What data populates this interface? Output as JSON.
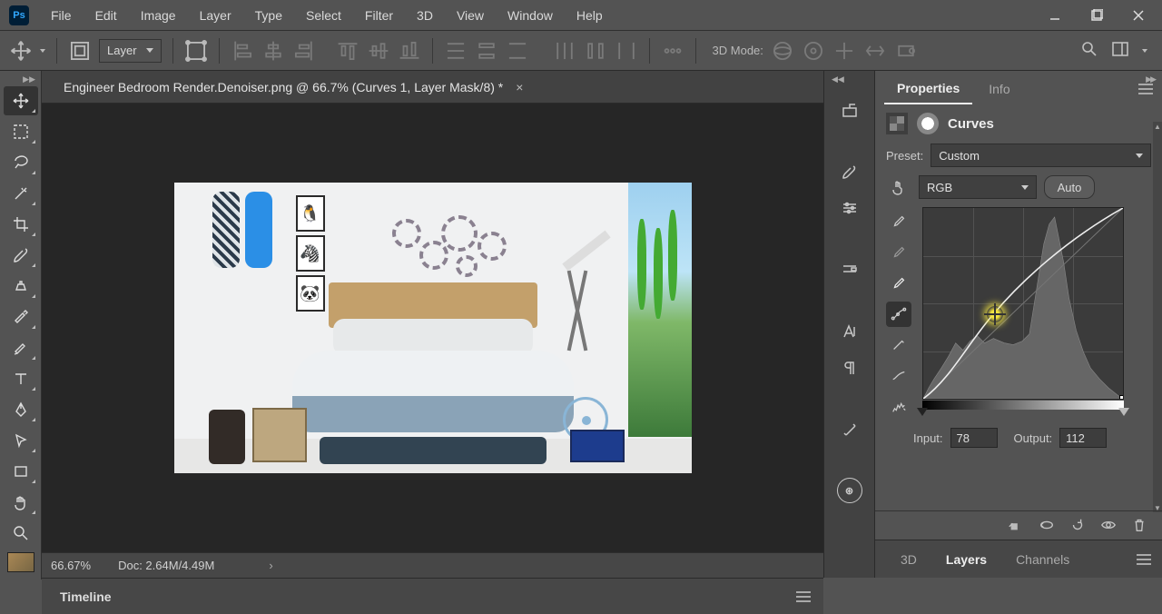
{
  "menubar": [
    "File",
    "Edit",
    "Image",
    "Layer",
    "Type",
    "Select",
    "Filter",
    "3D",
    "View",
    "Window",
    "Help"
  ],
  "options": {
    "target_select": "Layer",
    "mode3d_label": "3D Mode:"
  },
  "doc_tab": {
    "title": "Engineer Bedroom Render.Denoiser.png @ 66.7% (Curves 1, Layer Mask/8) *"
  },
  "status": {
    "zoom": "66.67%",
    "docinfo": "Doc: 2.64M/4.49M"
  },
  "panel": {
    "tabs": {
      "properties": "Properties",
      "info": "Info"
    },
    "title": "Curves",
    "preset_label": "Preset:",
    "preset_value": "Custom",
    "channel_value": "RGB",
    "auto_label": "Auto",
    "input_label": "Input:",
    "input_value": "78",
    "output_label": "Output:",
    "output_value": "112"
  },
  "bottom_tabs": {
    "threeD": "3D",
    "layers": "Layers",
    "channels": "Channels"
  },
  "timeline": {
    "label": "Timeline"
  }
}
